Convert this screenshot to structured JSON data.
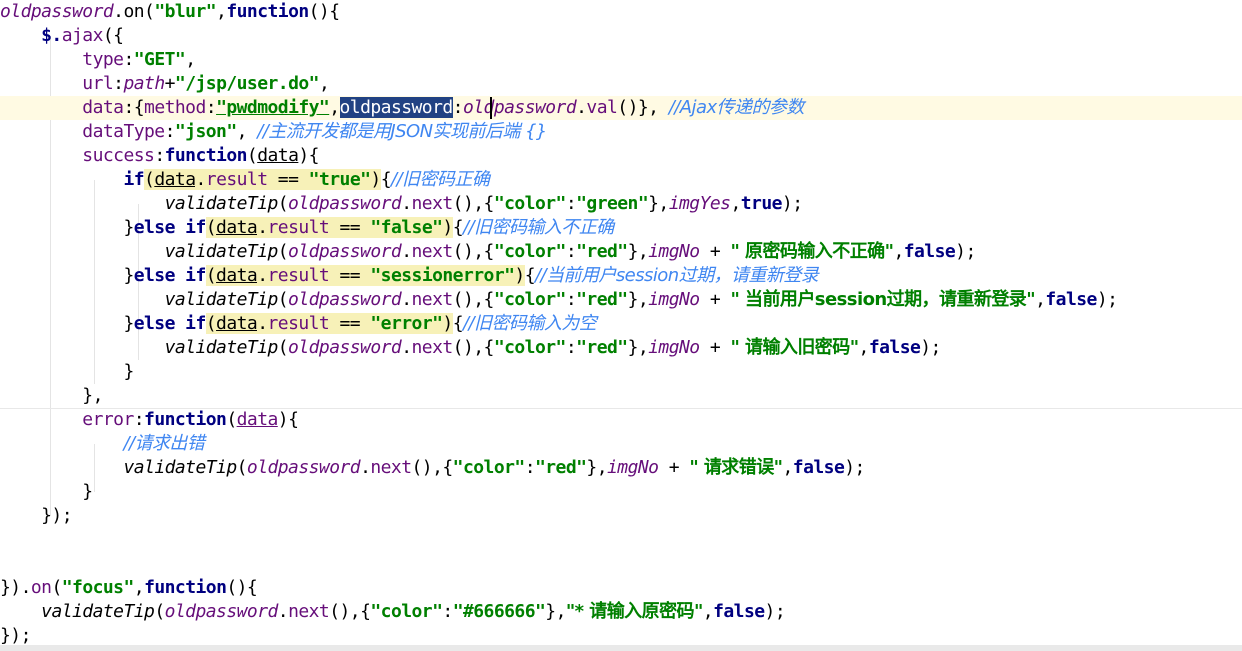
{
  "editor": {
    "lines": [
      {
        "tokens": [
          {
            "t": "oldpassword",
            "c": "gvar"
          },
          {
            "t": ".on(",
            "c": "pl"
          },
          {
            "t": "\"blur\"",
            "c": "str"
          },
          {
            "t": ",",
            "c": "pl"
          },
          {
            "t": "function",
            "c": "kw"
          },
          {
            "t": "(){",
            "c": "pl"
          }
        ]
      },
      {
        "tokens": [
          {
            "t": "    $.",
            "c": "kw"
          },
          {
            "t": "ajax",
            "c": "prop"
          },
          {
            "t": "({",
            "c": "pl"
          }
        ]
      },
      {
        "tokens": [
          {
            "t": "        ",
            "c": "pl"
          },
          {
            "t": "type",
            "c": "prop"
          },
          {
            "t": ":",
            "c": "pl"
          },
          {
            "t": "\"GET\"",
            "c": "str"
          },
          {
            "t": ",",
            "c": "pl"
          }
        ]
      },
      {
        "tokens": [
          {
            "t": "        ",
            "c": "pl"
          },
          {
            "t": "url",
            "c": "prop"
          },
          {
            "t": ":",
            "c": "pl"
          },
          {
            "t": "path",
            "c": "gvar"
          },
          {
            "t": "+",
            "c": "pl"
          },
          {
            "t": "\"/jsp/user.do\"",
            "c": "str"
          },
          {
            "t": ",",
            "c": "pl"
          }
        ]
      },
      {
        "current": true,
        "tokens": [
          {
            "t": "        ",
            "c": "pl"
          },
          {
            "t": "data",
            "c": "prop"
          },
          {
            "t": ":{",
            "c": "pl"
          },
          {
            "t": "method",
            "c": "prop"
          },
          {
            "t": ":",
            "c": "pl"
          },
          {
            "t": "\"pwdmodify\"",
            "c": "str ul"
          },
          {
            "t": ",",
            "c": "pl"
          },
          {
            "t": "oldpassword",
            "c": "sel"
          },
          {
            "t": ":",
            "c": "pl"
          },
          {
            "t": "oldpassword",
            "c": "gvar"
          },
          {
            "t": ".",
            "c": "pl"
          },
          {
            "t": "val",
            "c": "prop"
          },
          {
            "t": "()}, ",
            "c": "pl"
          },
          {
            "t": "//Ajax传递的参数",
            "c": "cmt"
          }
        ]
      },
      {
        "tokens": [
          {
            "t": "        ",
            "c": "pl"
          },
          {
            "t": "dataType",
            "c": "prop"
          },
          {
            "t": ":",
            "c": "pl"
          },
          {
            "t": "\"json\"",
            "c": "str"
          },
          {
            "t": ", ",
            "c": "pl"
          },
          {
            "t": "//主流开发都是用JSON实现前后端 {}",
            "c": "cmt"
          }
        ]
      },
      {
        "tokens": [
          {
            "t": "        ",
            "c": "pl"
          },
          {
            "t": "success",
            "c": "prop"
          },
          {
            "t": ":",
            "c": "pl"
          },
          {
            "t": "function",
            "c": "kw"
          },
          {
            "t": "(",
            "c": "pl"
          },
          {
            "t": "data",
            "c": "pl ul"
          },
          {
            "t": "){",
            "c": "pl"
          }
        ]
      },
      {
        "tokens": [
          {
            "t": "            ",
            "c": "pl"
          },
          {
            "t": "if",
            "c": "kw"
          },
          {
            "t": "(",
            "c": "hl"
          },
          {
            "t": "data",
            "c": "pl ul hl"
          },
          {
            "t": ".",
            "c": "hl"
          },
          {
            "t": "result",
            "c": "prop hl"
          },
          {
            "t": " == ",
            "c": "hl"
          },
          {
            "t": "\"true\"",
            "c": "str hl"
          },
          {
            "t": ")",
            "c": "hl"
          },
          {
            "t": "{",
            "c": "pl"
          },
          {
            "t": "//旧密码正确",
            "c": "cmt"
          }
        ]
      },
      {
        "tokens": [
          {
            "t": "                ",
            "c": "pl"
          },
          {
            "t": "validateTip",
            "c": "fn"
          },
          {
            "t": "(",
            "c": "pl"
          },
          {
            "t": "oldpassword",
            "c": "gvar"
          },
          {
            "t": ".",
            "c": "pl"
          },
          {
            "t": "next",
            "c": "prop"
          },
          {
            "t": "(),{",
            "c": "pl"
          },
          {
            "t": "\"color\"",
            "c": "str"
          },
          {
            "t": ":",
            "c": "pl"
          },
          {
            "t": "\"green\"",
            "c": "str"
          },
          {
            "t": "},",
            "c": "pl"
          },
          {
            "t": "imgYes",
            "c": "gvar"
          },
          {
            "t": ",",
            "c": "pl"
          },
          {
            "t": "true",
            "c": "kw"
          },
          {
            "t": ");",
            "c": "pl"
          }
        ]
      },
      {
        "tokens": [
          {
            "t": "            }",
            "c": "pl"
          },
          {
            "t": "else if",
            "c": "kw"
          },
          {
            "t": "(",
            "c": "hl"
          },
          {
            "t": "data",
            "c": "pl ul hl"
          },
          {
            "t": ".",
            "c": "hl"
          },
          {
            "t": "result",
            "c": "prop hl"
          },
          {
            "t": " == ",
            "c": "hl"
          },
          {
            "t": "\"false\"",
            "c": "str hl"
          },
          {
            "t": ")",
            "c": "hl"
          },
          {
            "t": "{",
            "c": "pl"
          },
          {
            "t": "//旧密码输入不正确",
            "c": "cmt"
          }
        ]
      },
      {
        "tokens": [
          {
            "t": "                ",
            "c": "pl"
          },
          {
            "t": "validateTip",
            "c": "fn"
          },
          {
            "t": "(",
            "c": "pl"
          },
          {
            "t": "oldpassword",
            "c": "gvar"
          },
          {
            "t": ".",
            "c": "pl"
          },
          {
            "t": "next",
            "c": "prop"
          },
          {
            "t": "(),{",
            "c": "pl"
          },
          {
            "t": "\"color\"",
            "c": "str"
          },
          {
            "t": ":",
            "c": "pl"
          },
          {
            "t": "\"red\"",
            "c": "str"
          },
          {
            "t": "},",
            "c": "pl"
          },
          {
            "t": "imgNo",
            "c": "gvar"
          },
          {
            "t": " + ",
            "c": "pl"
          },
          {
            "t": "\" 原密码输入不正确\"",
            "c": "str"
          },
          {
            "t": ",",
            "c": "pl"
          },
          {
            "t": "false",
            "c": "kw"
          },
          {
            "t": ");",
            "c": "pl"
          }
        ]
      },
      {
        "tokens": [
          {
            "t": "            }",
            "c": "pl"
          },
          {
            "t": "else if",
            "c": "kw"
          },
          {
            "t": "(",
            "c": "hl"
          },
          {
            "t": "data",
            "c": "pl ul hl"
          },
          {
            "t": ".",
            "c": "hl"
          },
          {
            "t": "result",
            "c": "prop hl"
          },
          {
            "t": " == ",
            "c": "hl"
          },
          {
            "t": "\"sessionerror\"",
            "c": "str hl"
          },
          {
            "t": ")",
            "c": "hl"
          },
          {
            "t": "{",
            "c": "pl"
          },
          {
            "t": "//当前用户session过期，请重新登录",
            "c": "cmt"
          }
        ]
      },
      {
        "tokens": [
          {
            "t": "                ",
            "c": "pl"
          },
          {
            "t": "validateTip",
            "c": "fn"
          },
          {
            "t": "(",
            "c": "pl"
          },
          {
            "t": "oldpassword",
            "c": "gvar"
          },
          {
            "t": ".",
            "c": "pl"
          },
          {
            "t": "next",
            "c": "prop"
          },
          {
            "t": "(),{",
            "c": "pl"
          },
          {
            "t": "\"color\"",
            "c": "str"
          },
          {
            "t": ":",
            "c": "pl"
          },
          {
            "t": "\"red\"",
            "c": "str"
          },
          {
            "t": "},",
            "c": "pl"
          },
          {
            "t": "imgNo",
            "c": "gvar"
          },
          {
            "t": " + ",
            "c": "pl"
          },
          {
            "t": "\" 当前用户session过期，请重新登录\"",
            "c": "str"
          },
          {
            "t": ",",
            "c": "pl"
          },
          {
            "t": "false",
            "c": "kw"
          },
          {
            "t": ");",
            "c": "pl"
          }
        ]
      },
      {
        "tokens": [
          {
            "t": "            }",
            "c": "pl"
          },
          {
            "t": "else if",
            "c": "kw"
          },
          {
            "t": "(",
            "c": "hl"
          },
          {
            "t": "data",
            "c": "pl ul hl"
          },
          {
            "t": ".",
            "c": "hl"
          },
          {
            "t": "result",
            "c": "prop hl"
          },
          {
            "t": " == ",
            "c": "hl"
          },
          {
            "t": "\"error\"",
            "c": "str hl"
          },
          {
            "t": ")",
            "c": "hl"
          },
          {
            "t": "{",
            "c": "pl"
          },
          {
            "t": "//旧密码输入为空",
            "c": "cmt"
          }
        ]
      },
      {
        "tokens": [
          {
            "t": "                ",
            "c": "pl"
          },
          {
            "t": "validateTip",
            "c": "fn"
          },
          {
            "t": "(",
            "c": "pl"
          },
          {
            "t": "oldpassword",
            "c": "gvar"
          },
          {
            "t": ".",
            "c": "pl"
          },
          {
            "t": "next",
            "c": "prop"
          },
          {
            "t": "(),{",
            "c": "pl"
          },
          {
            "t": "\"color\"",
            "c": "str"
          },
          {
            "t": ":",
            "c": "pl"
          },
          {
            "t": "\"red\"",
            "c": "str"
          },
          {
            "t": "},",
            "c": "pl"
          },
          {
            "t": "imgNo",
            "c": "gvar"
          },
          {
            "t": " + ",
            "c": "pl"
          },
          {
            "t": "\" 请输入旧密码\"",
            "c": "str"
          },
          {
            "t": ",",
            "c": "pl"
          },
          {
            "t": "false",
            "c": "kw"
          },
          {
            "t": ");",
            "c": "pl"
          }
        ]
      },
      {
        "tokens": [
          {
            "t": "            }",
            "c": "pl"
          }
        ]
      },
      {
        "sep": true,
        "tokens": [
          {
            "t": "        },",
            "c": "pl"
          }
        ]
      },
      {
        "tokens": [
          {
            "t": "        ",
            "c": "pl"
          },
          {
            "t": "error",
            "c": "prop"
          },
          {
            "t": ":",
            "c": "pl"
          },
          {
            "t": "function",
            "c": "kw"
          },
          {
            "t": "(",
            "c": "pl"
          },
          {
            "t": "data",
            "c": "prop ul"
          },
          {
            "t": "){",
            "c": "pl"
          }
        ]
      },
      {
        "tokens": [
          {
            "t": "            ",
            "c": "pl"
          },
          {
            "t": "//请求出错",
            "c": "cmt"
          }
        ]
      },
      {
        "tokens": [
          {
            "t": "            ",
            "c": "pl"
          },
          {
            "t": "validateTip",
            "c": "fn"
          },
          {
            "t": "(",
            "c": "pl"
          },
          {
            "t": "oldpassword",
            "c": "gvar"
          },
          {
            "t": ".",
            "c": "pl"
          },
          {
            "t": "next",
            "c": "prop"
          },
          {
            "t": "(),{",
            "c": "pl"
          },
          {
            "t": "\"color\"",
            "c": "str"
          },
          {
            "t": ":",
            "c": "pl"
          },
          {
            "t": "\"red\"",
            "c": "str"
          },
          {
            "t": "},",
            "c": "pl"
          },
          {
            "t": "imgNo",
            "c": "gvar"
          },
          {
            "t": " + ",
            "c": "pl"
          },
          {
            "t": "\" 请求错误\"",
            "c": "str"
          },
          {
            "t": ",",
            "c": "pl"
          },
          {
            "t": "false",
            "c": "kw"
          },
          {
            "t": ");",
            "c": "pl"
          }
        ]
      },
      {
        "tokens": [
          {
            "t": "        }",
            "c": "pl"
          }
        ]
      },
      {
        "tokens": [
          {
            "t": "    });",
            "c": "pl"
          }
        ]
      },
      {
        "tokens": []
      },
      {
        "tokens": []
      },
      {
        "tokens": [
          {
            "t": "}).",
            "c": "pl"
          },
          {
            "t": "on",
            "c": "prop"
          },
          {
            "t": "(",
            "c": "pl"
          },
          {
            "t": "\"focus\"",
            "c": "str"
          },
          {
            "t": ",",
            "c": "pl"
          },
          {
            "t": "function",
            "c": "kw"
          },
          {
            "t": "(){",
            "c": "pl"
          }
        ]
      },
      {
        "tokens": [
          {
            "t": "    ",
            "c": "pl"
          },
          {
            "t": "validateTip",
            "c": "fn"
          },
          {
            "t": "(",
            "c": "pl"
          },
          {
            "t": "oldpassword",
            "c": "gvar"
          },
          {
            "t": ".",
            "c": "pl"
          },
          {
            "t": "next",
            "c": "prop"
          },
          {
            "t": "(),{",
            "c": "pl"
          },
          {
            "t": "\"color\"",
            "c": "str"
          },
          {
            "t": ":",
            "c": "pl"
          },
          {
            "t": "\"#666666\"",
            "c": "str"
          },
          {
            "t": "},",
            "c": "pl"
          },
          {
            "t": "\"* 请输入原密码\"",
            "c": "str"
          },
          {
            "t": ",",
            "c": "pl"
          },
          {
            "t": "false",
            "c": "kw"
          },
          {
            "t": ");",
            "c": "pl"
          }
        ]
      },
      {
        "tokens": [
          {
            "t": "});",
            "c": "pl"
          }
        ]
      }
    ]
  },
  "colors": {
    "keyword": "#000080",
    "string": "#008000",
    "global_var": "#660e7a",
    "comment": "#3f86f1",
    "current_line": "#fffae3",
    "selection": "#214283"
  }
}
